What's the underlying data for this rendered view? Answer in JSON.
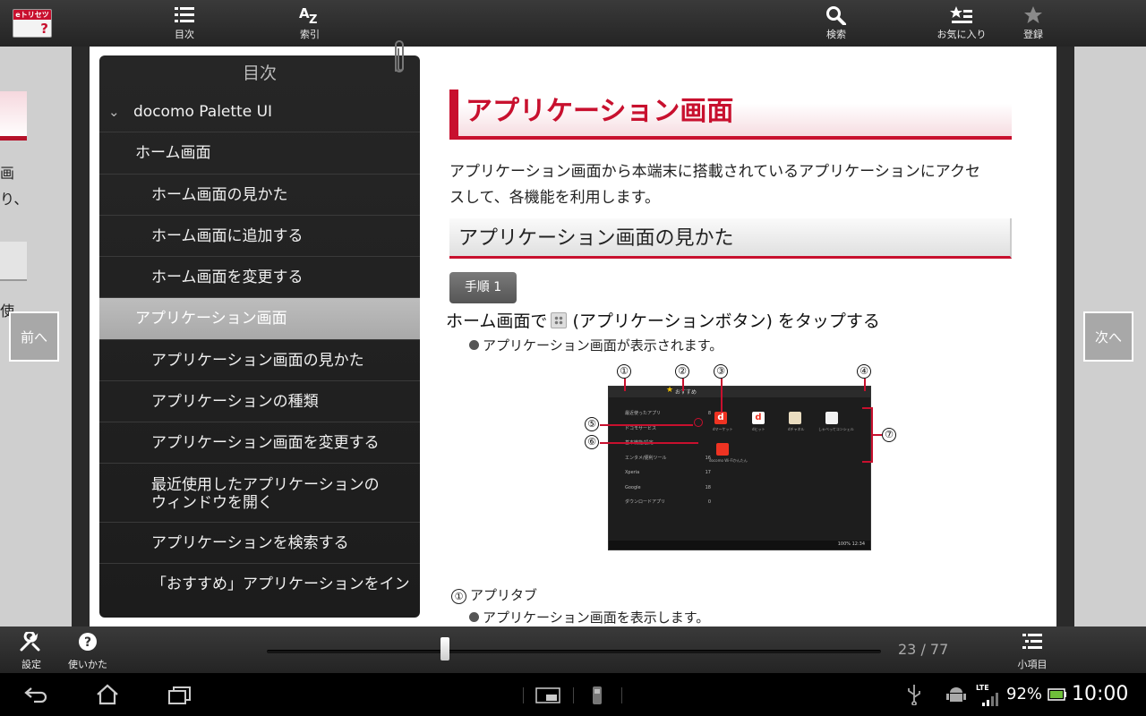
{
  "topbar": {
    "logo_text": "eトリセツ",
    "logo_mark": "?",
    "buttons": [
      {
        "label": "目次",
        "icon": "list-icon"
      },
      {
        "label": "索引",
        "icon": "az-index-icon"
      },
      {
        "label": "検索",
        "icon": "search-icon"
      },
      {
        "label": "お気に入り",
        "icon": "favorites-list-icon"
      },
      {
        "label": "登録",
        "icon": "star-icon"
      }
    ]
  },
  "side_left": {
    "fragments": [
      "画",
      "り、",
      "使"
    ],
    "prev_label": "前へ"
  },
  "side_right": {
    "next_label": "次へ"
  },
  "toc": {
    "title": "目次",
    "chevron": "›",
    "items": [
      {
        "label": "docomo Palette UI",
        "level": 1
      },
      {
        "label": "ホーム画面",
        "level": 2
      },
      {
        "label": "ホーム画面の見かた",
        "level": 3
      },
      {
        "label": "ホーム画面に追加する",
        "level": 3
      },
      {
        "label": "ホーム画面を変更する",
        "level": 3
      },
      {
        "label": "アプリケーション画面",
        "level": 2,
        "active": true
      },
      {
        "label": "アプリケーション画面の見かた",
        "level": 3
      },
      {
        "label": "アプリケーションの種類",
        "level": 3
      },
      {
        "label": "アプリケーション画面を変更する",
        "level": 3
      },
      {
        "label": "最近使用したアプリケーションのウィンドウを開く",
        "level": 3,
        "line1": "最近使用したアプリケーションの",
        "line2": "ウィンドウを開く"
      },
      {
        "label": "アプリケーションを検索する",
        "level": 3
      },
      {
        "label": "「おすすめ」アプリケーションをイン",
        "level": 3
      }
    ]
  },
  "content": {
    "title": "アプリケーション画面",
    "intro_line1": "アプリケーション画面から本端末に搭載されているアプリケーションにアクセ",
    "intro_line2": "スして、各機能を利用します。",
    "section_title": "アプリケーション画面の見かた",
    "step_label": "手順 1",
    "step_text_before": "ホーム画面で",
    "step_text_after": "(アプリケーションボタン) をタップする",
    "step_note": "アプリケーション画面が表示されます。",
    "callouts": [
      "①",
      "②",
      "③",
      "④",
      "⑤",
      "⑥",
      "⑦"
    ],
    "item1_num": "①",
    "item1_label": "アプリタブ",
    "item1_desc": "アプリケーション画面を表示します。"
  },
  "screenshot": {
    "tab_label": "おすすめ",
    "categories": [
      {
        "label": "最近使ったアプリ",
        "count": "8"
      },
      {
        "label": "ドコモサービス",
        "count": ""
      },
      {
        "label": "基本機能/設定",
        "count": ""
      },
      {
        "label": "エンタメ/便利ツール",
        "count": "16"
      },
      {
        "label": "Xperia",
        "count": "17"
      },
      {
        "label": "Google",
        "count": "18"
      },
      {
        "label": "ダウンロードアプリ",
        "count": "0"
      }
    ],
    "apps": [
      "dマーケット",
      "dヒット",
      "dチャネル",
      "しゃべってコンシェル",
      "docomo Wi-Fiかんたん"
    ],
    "status_time": "100% 12:34"
  },
  "bottombar": {
    "settings_label": "設定",
    "help_label": "使いかた",
    "page_current": "23",
    "page_total": "77",
    "page_text": "23 / 77",
    "subitems_label": "小項目",
    "progress": 0.29
  },
  "sysbar": {
    "network": "LTE",
    "battery": "92%",
    "clock": "10:00"
  },
  "colors": {
    "accent": "#c8102e",
    "toolbar": "#2e2e2e",
    "toc_bg": "#222222",
    "toc_active": "#b3b3b3"
  }
}
